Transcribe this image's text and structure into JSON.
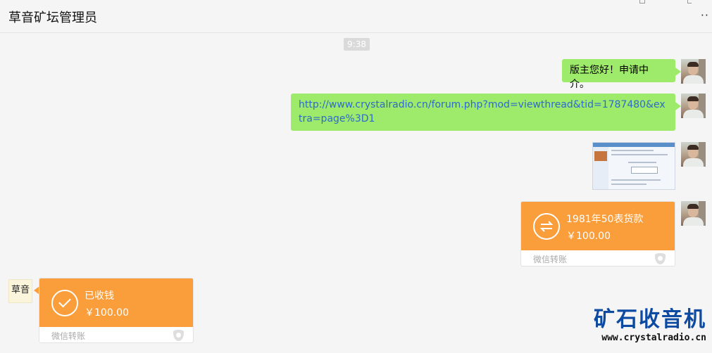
{
  "header": {
    "title": "草音矿坛管理员",
    "more_icon": "more-dots-icon"
  },
  "time": "9:38",
  "messages": {
    "m1": "版主您好！申请中介。",
    "m2_link": "http://www.crystalradio.cn/forum.php?mod=viewthread&tid=1787480&extra=page%3D1"
  },
  "transfer_out": {
    "note": "1981年50表货款",
    "amount": "￥100.00",
    "label": "微信转账",
    "icon": "exchange-arrows-icon"
  },
  "transfer_in": {
    "status": "已收钱",
    "amount": "￥100.00",
    "label": "微信转账",
    "icon": "check-icon"
  },
  "left_avatar_text": "草音",
  "watermark": {
    "brand": "矿石收音机",
    "url": "www.crystalradio.cn"
  },
  "colors": {
    "green_bubble": "#9eea6a",
    "transfer_orange": "#fa9d3b",
    "link": "#2d6bcc"
  }
}
